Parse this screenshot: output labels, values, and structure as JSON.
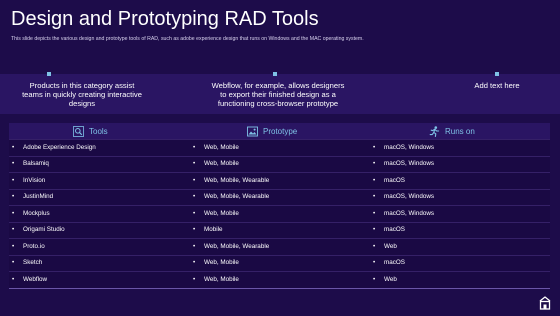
{
  "slide": {
    "title": "Design and Prototyping RAD Tools",
    "subtitle": "This slide depicts the various  design and prototype tools of RAD, such as adobe  experience design that runs on Windows and the MAC operating system."
  },
  "callouts": [
    {
      "lines": [
        "Products in this category assist",
        "teams in quickly creating interactive",
        "designs"
      ]
    },
    {
      "lines": [
        "Webflow, for example, allows designers",
        "to export their finished design as a",
        "functioning cross-browser prototype"
      ]
    },
    {
      "lines": [
        "Add text here"
      ]
    }
  ],
  "table": {
    "headers": [
      {
        "label": "Tools",
        "icon": "search-icon"
      },
      {
        "label": "Prototype",
        "icon": "image-icon"
      },
      {
        "label": "Runs on",
        "icon": "runner-icon"
      }
    ],
    "bullet": "•",
    "rows": [
      [
        "Adobe Experience Design",
        "Web, Mobile",
        "macOS, Windows"
      ],
      [
        "Balsamiq",
        "Web, Mobile",
        "macOS, Windows"
      ],
      [
        "InVision",
        "Web, Mobile, Wearable",
        "macOS"
      ],
      [
        "JustinMind",
        "Web, Mobile, Wearable",
        "macOS, Windows"
      ],
      [
        "Mockplus",
        "Web, Mobile",
        "macOS, Windows"
      ],
      [
        "Origami Studio",
        "Mobile",
        "macOS"
      ],
      [
        "Proto.io",
        "Web, Mobile, Wearable",
        "Web"
      ],
      [
        "Sketch",
        "Web, Mobile",
        "macOS"
      ],
      [
        "Webflow",
        "Web, Mobile",
        "Web"
      ]
    ]
  },
  "colors": {
    "background": "#1d0c4a",
    "band": "#2a1563",
    "accent": "#7fc2e6"
  },
  "corner_icon": "home-icon"
}
